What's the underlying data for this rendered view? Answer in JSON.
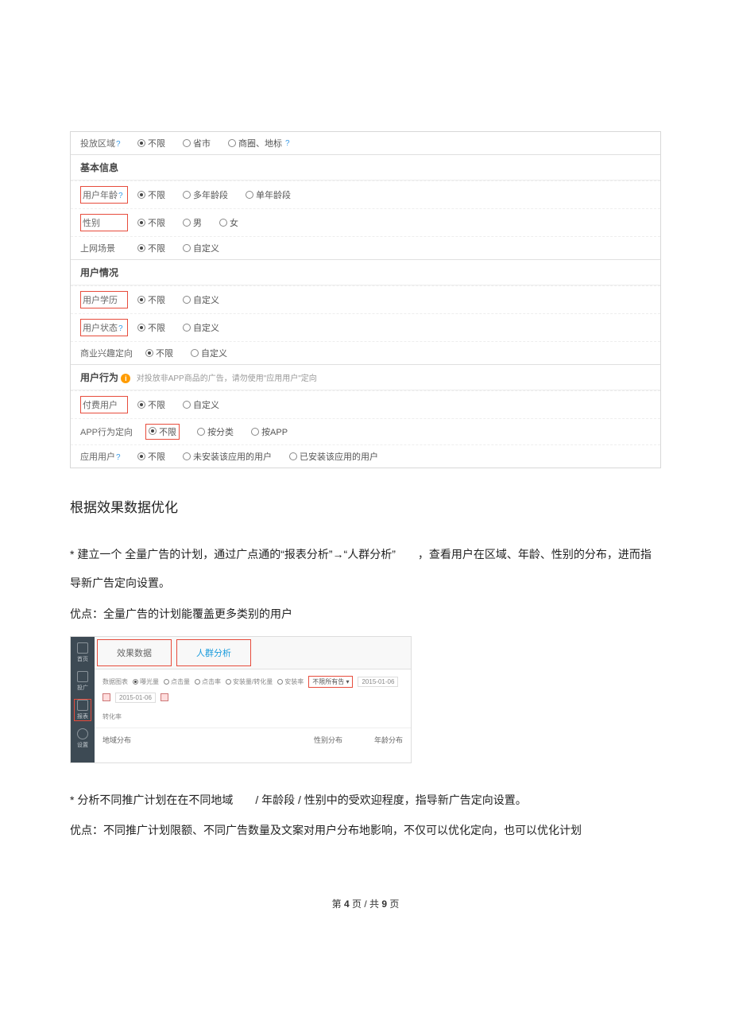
{
  "panel": {
    "top_row": {
      "label": "投放区域",
      "options": [
        "不限",
        "省市",
        "商圈、地标"
      ]
    },
    "s1": {
      "title": "基本信息",
      "rows": [
        {
          "label": "用户年龄",
          "boxed": true,
          "q": true,
          "options": [
            "不限",
            "多年龄段",
            "单年龄段"
          ]
        },
        {
          "label": "性别",
          "boxed": true,
          "q": false,
          "options": [
            "不限",
            "男",
            "女"
          ]
        },
        {
          "label": "上网场景",
          "boxed": false,
          "q": false,
          "options": [
            "不限",
            "自定义"
          ]
        }
      ]
    },
    "s2": {
      "title": "用户情况",
      "rows": [
        {
          "label": "用户学历",
          "boxed": true,
          "q": false,
          "options": [
            "不限",
            "自定义"
          ]
        },
        {
          "label": "用户状态",
          "boxed": true,
          "q": true,
          "options": [
            "不限",
            "自定义"
          ]
        },
        {
          "label": "商业兴趣定向",
          "boxed": false,
          "q": false,
          "options": [
            "不限",
            "自定义"
          ]
        }
      ]
    },
    "s3": {
      "title": "用户行为",
      "note": "对投放非APP商品的广告，请勿使用\"应用用户\"定向",
      "rows": [
        {
          "label": "付费用户",
          "boxed": true,
          "q": false,
          "options": [
            "不限",
            "自定义"
          ]
        },
        {
          "label": "APP行为定向",
          "boxed": false,
          "q": false,
          "options": [
            "不限",
            "按分类",
            "按APP"
          ],
          "label_boxed_alt": true
        },
        {
          "label": "应用用户",
          "boxed": false,
          "q": true,
          "options": [
            "不限",
            "未安装该应用的用户",
            "已安装该应用的用户"
          ]
        }
      ]
    }
  },
  "body": {
    "h2": "根据效果数据优化",
    "p1": "*  建立一个 全量广告的计划，通过广点通的“报表分析”→“人群分析”　　，查看用户在区域、年龄、性别的分布，进而指导新广告定向设置。",
    "p2": "优点：全量广告的计划能覆盖更多类别的用户",
    "p3": "*  分析不同推广计划在在不同地域　　/ 年龄段 / 性别中的受欢迎程度，指导新广告定向设置。",
    "p4": "优点：不同推广计划限额、不同广告数量及文案对用户分布地影响，不仅可以优化定向，也可以优化计划"
  },
  "fig2": {
    "side": [
      "首页",
      "投广",
      "报表",
      "设置"
    ],
    "tabs": [
      "效果数据",
      "人群分析"
    ],
    "ctrl_label": "数据图表",
    "metrics": [
      "曝光量",
      "点击量",
      "点击率",
      "安装量/转化量",
      "安装率"
    ],
    "dropdown": "不限所有告",
    "date1": "2015-01-06",
    "date2": "2015-01-06",
    "extra_metric": "转化率",
    "cols": [
      "地域分布",
      "性别分布",
      "年龄分布"
    ]
  },
  "footer": {
    "prefix": "第 ",
    "page": "4",
    "mid": " 页 / 共 ",
    "total": "9",
    "suffix": " 页"
  }
}
